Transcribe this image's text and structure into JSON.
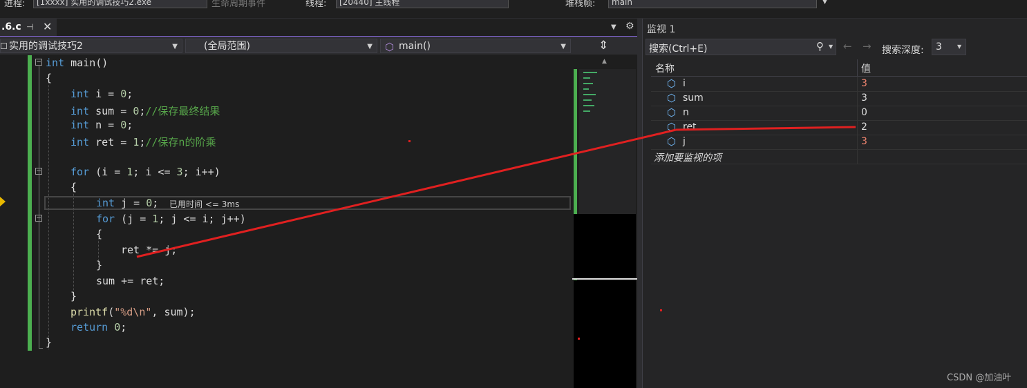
{
  "toolbar": {
    "process_label": "进程:",
    "process_value": "[1xxxx] 实用的调试技巧2.exe",
    "lifecycle_label": "生命周期事件",
    "thread_label": "线程:",
    "thread_value": "[20440] 主线程",
    "stack_label": "堆栈帧:",
    "stack_value": "main"
  },
  "tab": {
    "title": ".6.c",
    "pin_icon": "pin-icon",
    "close_icon": "close-icon"
  },
  "navbar": {
    "project": "实用的调试技巧2",
    "scope": "(全局范围)",
    "function": "main()"
  },
  "editor": {
    "current_line_hint": "已用时间 <= 3ms"
  },
  "watch": {
    "title": "监视 1",
    "search_placeholder": "搜索(Ctrl+E)",
    "depth_label": "搜索深度:",
    "depth_value": "3",
    "col_name": "名称",
    "col_value": "值",
    "rows": [
      {
        "name": "i",
        "value": "3",
        "changed": true
      },
      {
        "name": "sum",
        "value": "3",
        "changed": false
      },
      {
        "name": "n",
        "value": "0",
        "changed": false
      },
      {
        "name": "ret",
        "value": "2",
        "changed": false
      },
      {
        "name": "j",
        "value": "3",
        "changed": true
      }
    ],
    "add_item": "添加要监视的项"
  },
  "watermark": "CSDN @加油叶",
  "colors": {
    "accent": "#8a6be0",
    "changed_value": "#f48771",
    "change_bar": "#4caf50",
    "annotation": "#e02020"
  }
}
